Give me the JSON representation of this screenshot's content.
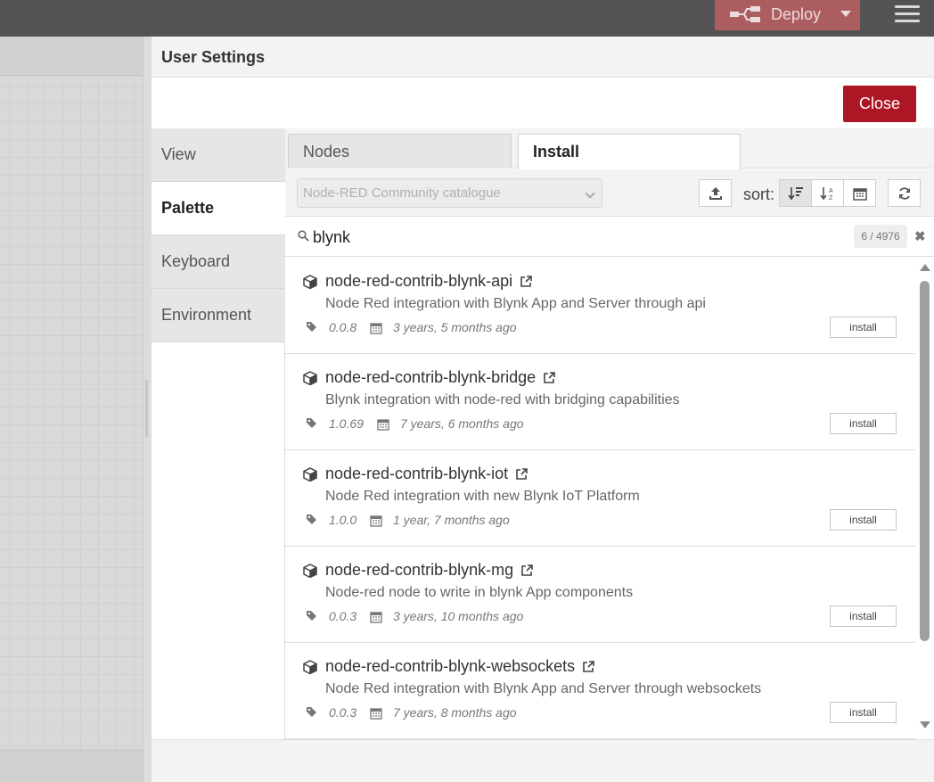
{
  "header": {
    "deploy_label": "Deploy"
  },
  "dialog": {
    "title": "User Settings",
    "close_label": "Close",
    "side_tabs": [
      {
        "label": "View"
      },
      {
        "label": "Palette"
      },
      {
        "label": "Keyboard"
      },
      {
        "label": "Environment"
      }
    ],
    "active_side_tab": "Palette"
  },
  "palette": {
    "tabs": [
      {
        "label": "Nodes"
      },
      {
        "label": "Install"
      }
    ],
    "active_tab": "Install",
    "catalog": "Node-RED Community catalogue",
    "sort_label": "sort:",
    "search_value": "blynk",
    "count": "6 / 4976",
    "install_label": "install",
    "nodes": [
      {
        "name": "node-red-contrib-blynk-api",
        "description": "Node Red integration with Blynk App and Server through api",
        "version": "0.0.8",
        "updated": "3 years, 5 months ago"
      },
      {
        "name": "node-red-contrib-blynk-bridge",
        "description": "Blynk integration with node-red with bridging capabilities",
        "version": "1.0.69",
        "updated": "7 years, 6 months ago"
      },
      {
        "name": "node-red-contrib-blynk-iot",
        "description": "Node Red integration with new Blynk IoT Platform",
        "version": "1.0.0",
        "updated": "1 year, 7 months ago"
      },
      {
        "name": "node-red-contrib-blynk-mg",
        "description": "Node-red node to write in blynk App components",
        "version": "0.0.3",
        "updated": "3 years, 10 months ago"
      },
      {
        "name": "node-red-contrib-blynk-websockets",
        "description": "Node Red integration with Blynk App and Server through websockets",
        "version": "0.0.3",
        "updated": "7 years, 8 months ago"
      }
    ]
  },
  "colors": {
    "header_bg": "#535353",
    "deploy_bg": "#ac5d60",
    "close_bg": "#ad1625"
  }
}
